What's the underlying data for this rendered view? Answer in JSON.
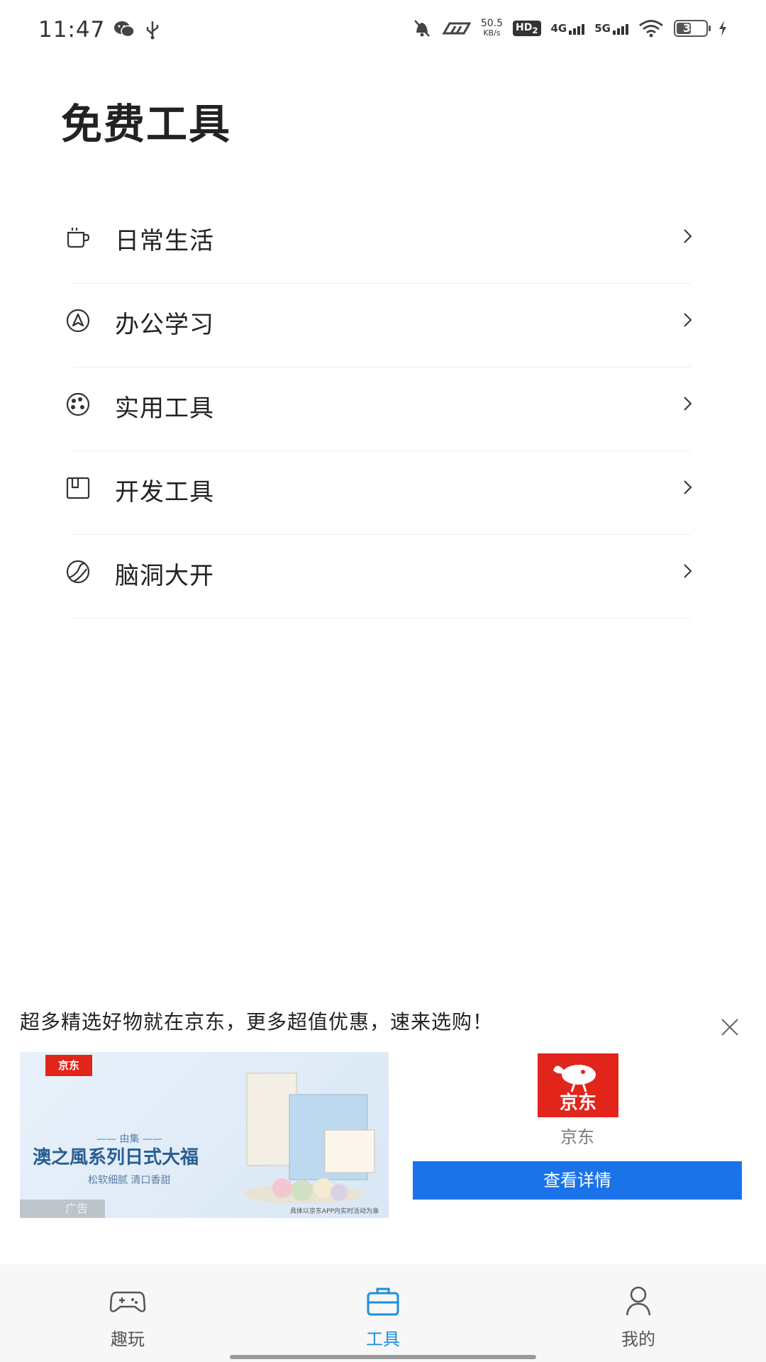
{
  "status_bar": {
    "time": "11:47",
    "net_speed_value": "50.5",
    "net_speed_unit": "KB/s",
    "hd_label": "HD",
    "hd_sub": "2",
    "net1": "4G",
    "net2": "5G",
    "battery_level": "31",
    "icons": [
      "wechat-icon",
      "usb-icon",
      "mute-bell-icon",
      "nfc-icon",
      "wifi-icon",
      "charging-icon"
    ]
  },
  "page": {
    "title": "免费工具"
  },
  "menu": {
    "items": [
      {
        "label": "日常生活",
        "icon": "cup-icon"
      },
      {
        "label": "办公学习",
        "icon": "navigate-circle-icon"
      },
      {
        "label": "实用工具",
        "icon": "palette-icon"
      },
      {
        "label": "开发工具",
        "icon": "box-icon"
      },
      {
        "label": "脑洞大开",
        "icon": "ball-icon"
      }
    ]
  },
  "ad": {
    "text": "超多精选好物就在京东，更多超值优惠，速来选购！",
    "image": {
      "jd_tag": "京东",
      "subtitle": "—— 由集 ——",
      "headline": "澳之風系列日式大福",
      "tagline": "松软细腻 清口香甜",
      "badge": "广告",
      "disclaimer": "具体以京东APP内实时活动为准"
    },
    "brand_logo_text": "京东",
    "brand_name": "京东",
    "button_label": "查看详情"
  },
  "bottom_nav": {
    "items": [
      {
        "label": "趣玩",
        "icon": "gamepad-icon",
        "active": false
      },
      {
        "label": "工具",
        "icon": "toolbox-icon",
        "active": true
      },
      {
        "label": "我的",
        "icon": "person-icon",
        "active": false
      }
    ]
  },
  "colors": {
    "accent": "#1b8fd9",
    "ad_button": "#1a73e8",
    "jd_red": "#e1251b"
  }
}
